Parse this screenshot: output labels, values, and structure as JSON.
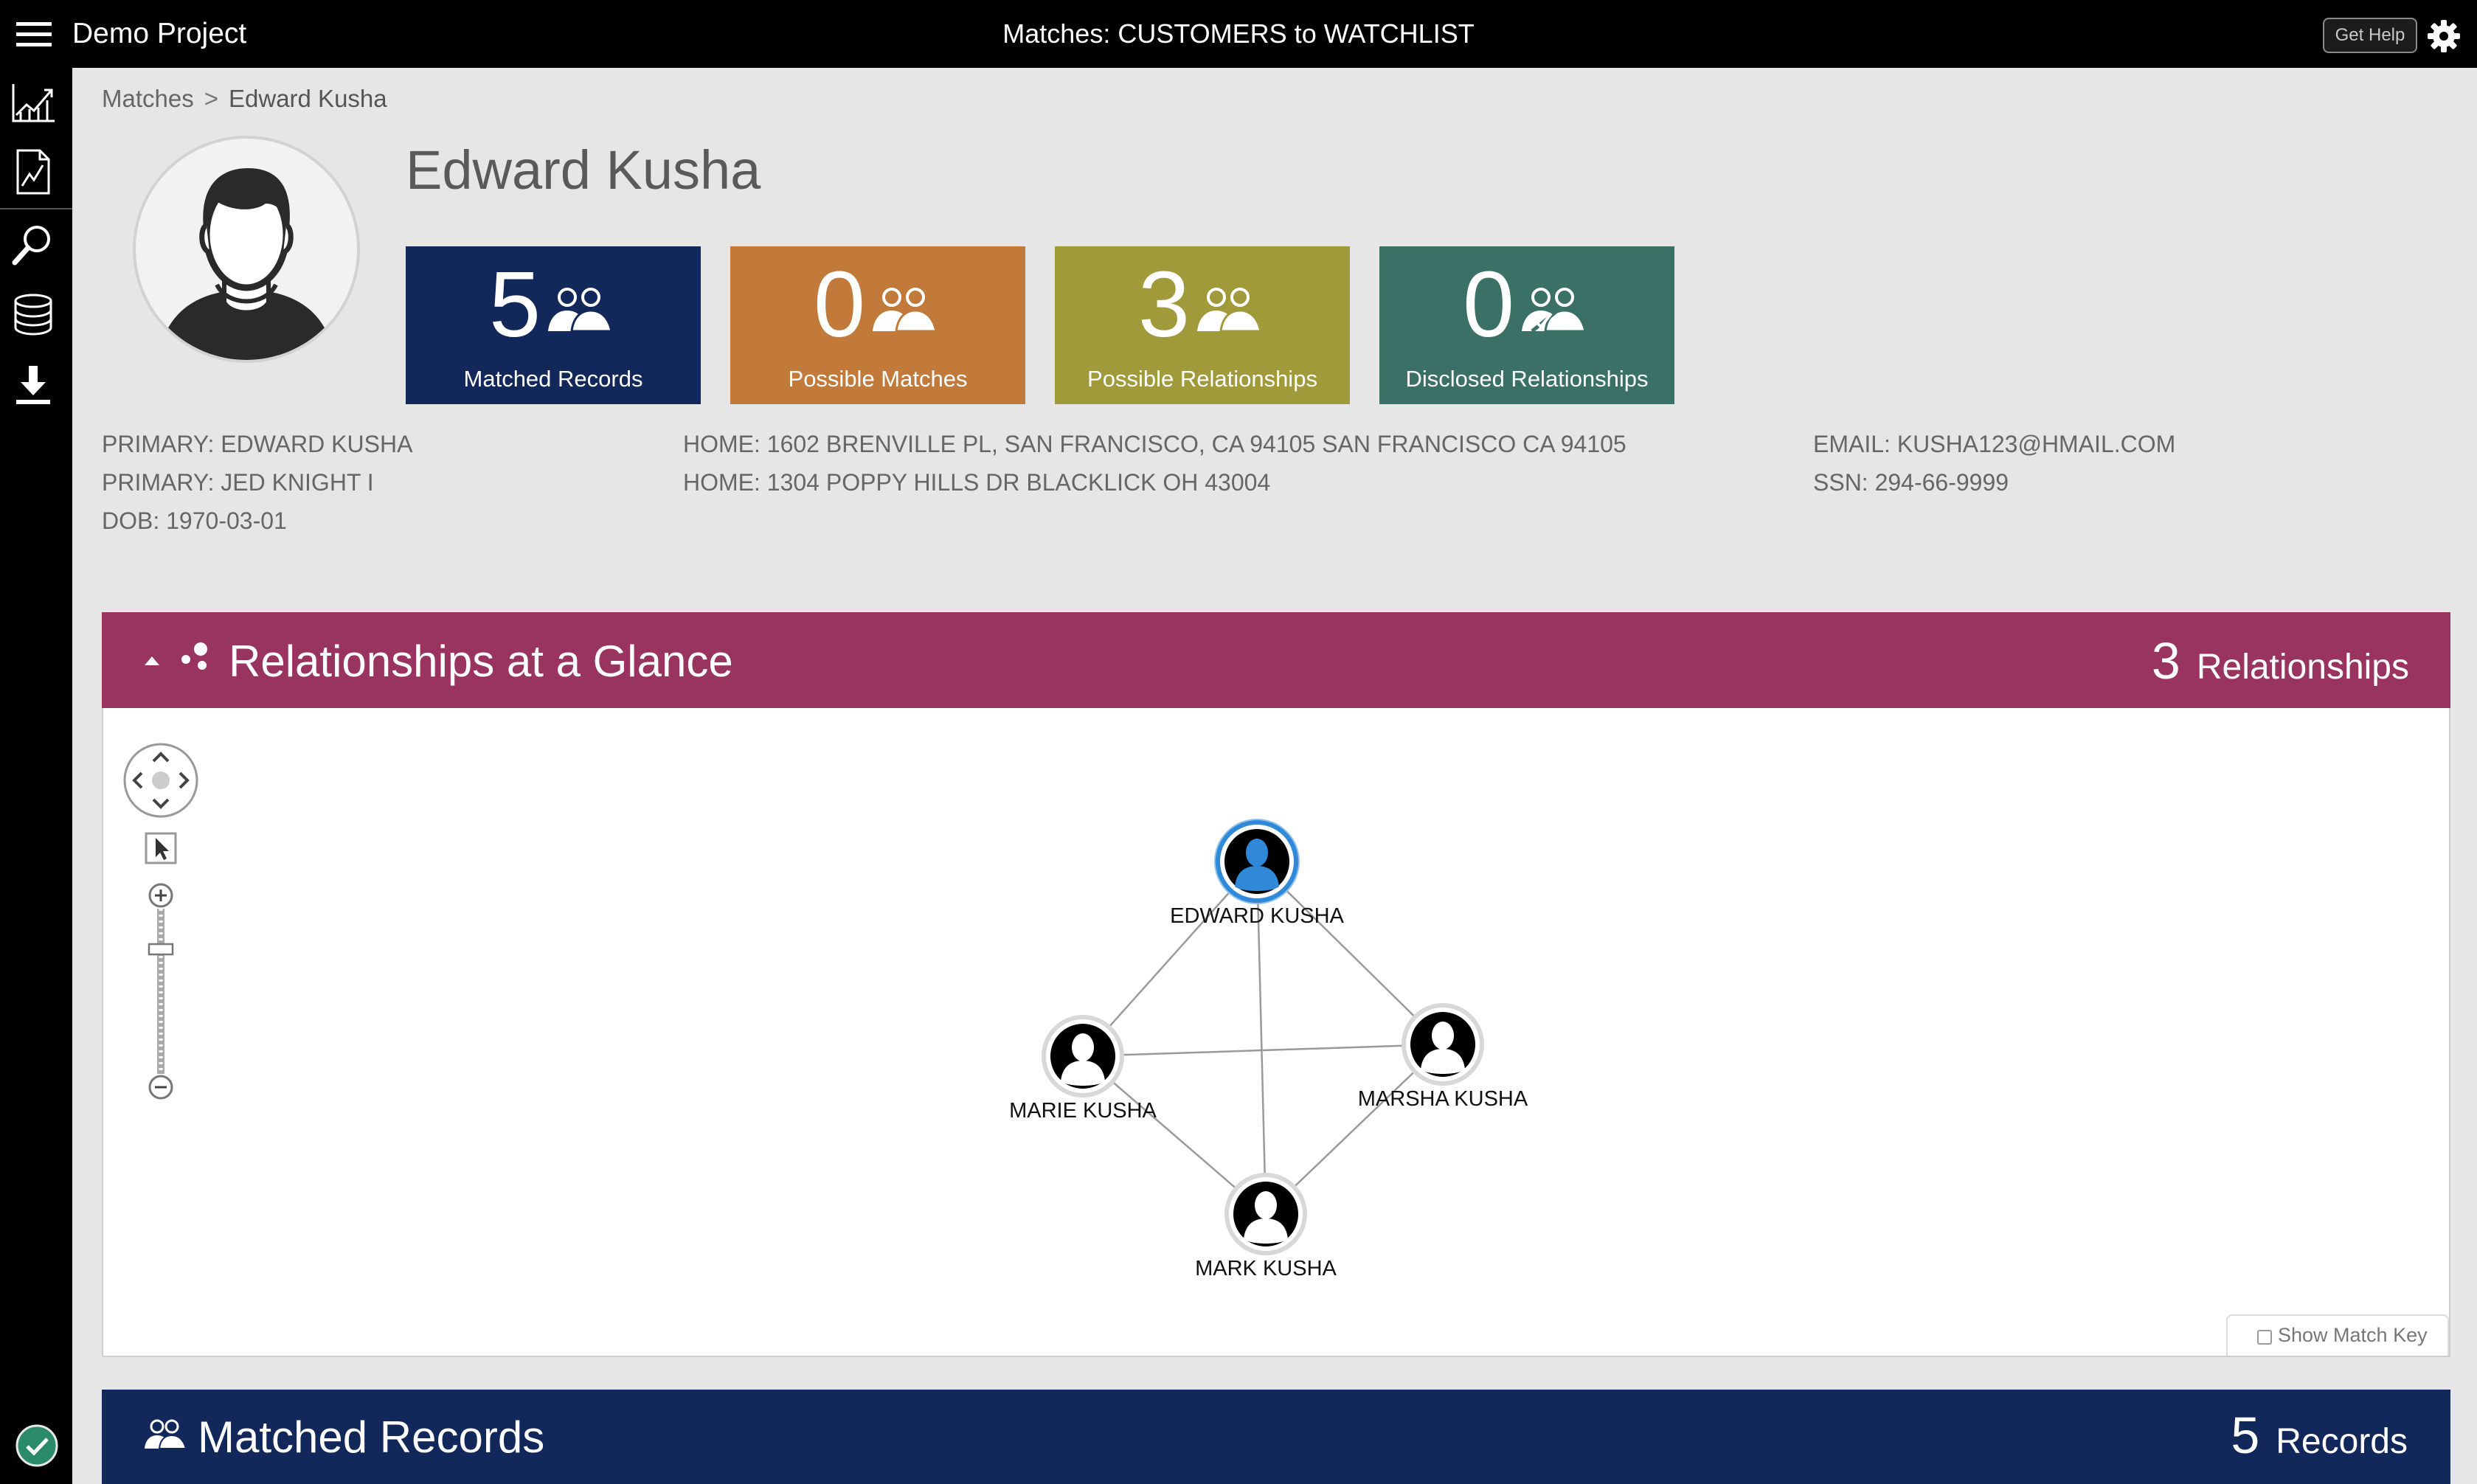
{
  "header": {
    "project_name": "Demo Project",
    "title": "Matches: CUSTOMERS to WATCHLIST",
    "help_label": "Get Help",
    "icons": [
      "menu-icon",
      "gear-icon"
    ]
  },
  "sidebar": {
    "items": [
      "chart-icon",
      "document-icon",
      "search-icon",
      "database-icon",
      "download-icon"
    ],
    "status_icon": "check-circle-icon"
  },
  "breadcrumb": {
    "root": "Matches",
    "separator": ">",
    "current": "Edward Kusha"
  },
  "entity": {
    "name": "Edward Kusha",
    "stats": [
      {
        "count": "5",
        "label": "Matched Records",
        "color": "#12275a"
      },
      {
        "count": "0",
        "label": "Possible Matches",
        "color": "#c27a3a"
      },
      {
        "count": "3",
        "label": "Possible Relationships",
        "color": "#a19a3a"
      },
      {
        "count": "0",
        "label": "Disclosed Relationships",
        "color": "#3a7066"
      }
    ],
    "names": [
      "PRIMARY: EDWARD KUSHA",
      "PRIMARY: JED KNIGHT I",
      "DOB: 1970-03-01"
    ],
    "addresses": [
      "HOME: 1602 BRENVILLE PL, SAN FRANCISCO, CA 94105 SAN FRANCISCO CA 94105",
      "HOME: 1304 POPPY HILLS DR BLACKLICK OH 43004"
    ],
    "contacts": [
      "EMAIL: KUSHA123@HMAIL.COM",
      "SSN: 294-66-9999"
    ]
  },
  "relationships": {
    "title": "Relationships at a Glance",
    "count": "3",
    "count_label": "Relationships",
    "color": "#993460",
    "graph": {
      "nodes": [
        {
          "id": "edward",
          "label": "EDWARD KUSHA",
          "focus": true
        },
        {
          "id": "marie",
          "label": "MARIE KUSHA",
          "focus": false
        },
        {
          "id": "marsha",
          "label": "MARSHA KUSHA",
          "focus": false
        },
        {
          "id": "mark",
          "label": "MARK KUSHA",
          "focus": false
        }
      ],
      "edges": [
        [
          "edward",
          "marie"
        ],
        [
          "edward",
          "marsha"
        ],
        [
          "edward",
          "mark"
        ],
        [
          "marie",
          "marsha"
        ],
        [
          "marie",
          "mark"
        ],
        [
          "marsha",
          "mark"
        ]
      ]
    },
    "show_match_key_label": "Show Match Key"
  },
  "matched_records": {
    "title": "Matched Records",
    "count": "5",
    "count_label": "Records",
    "color": "#12275a"
  }
}
